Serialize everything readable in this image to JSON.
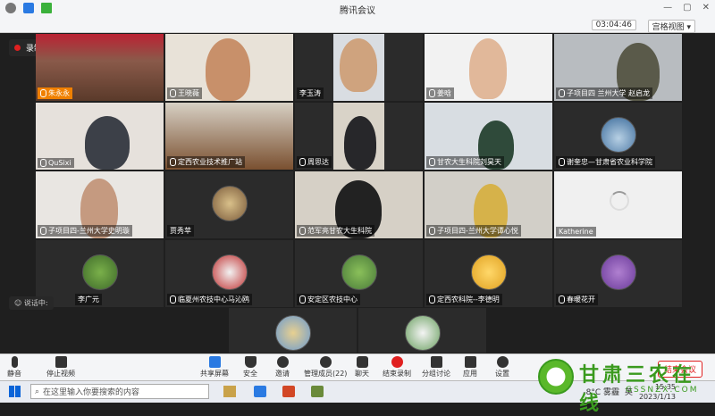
{
  "window": {
    "title": "腾讯会议",
    "timer": "03:04:46",
    "view_label": "宫格视图"
  },
  "recording": {
    "label": "录制中"
  },
  "speaking_label": "说话中:",
  "participants": [
    {
      "name": "朱永永"
    },
    {
      "name": "王晓薇"
    },
    {
      "name": "李玉涛"
    },
    {
      "name": "姜晗"
    },
    {
      "name": "子项目四 兰州大学 赵启龙"
    },
    {
      "name": "QuSixi"
    },
    {
      "name": "定西农业技术推广站"
    },
    {
      "name": "周思达"
    },
    {
      "name": "甘农大生科院刘昊天"
    },
    {
      "name": "谢奎忠—甘肃省农业科学院"
    },
    {
      "name": "子项目四-兰州大学史明璇"
    },
    {
      "name": "贾秀苹"
    },
    {
      "name": "范军亮甘农大生科院"
    },
    {
      "name": "子项目四-兰州大学谭心悦"
    },
    {
      "name": "Katherine"
    },
    {
      "name": "李广元"
    },
    {
      "name": "临夏州农技中心马沁鸥"
    },
    {
      "name": "安定区农技中心"
    },
    {
      "name": "定西农科院--李德明"
    },
    {
      "name": "春暖花开"
    }
  ],
  "bottom_toolbar": {
    "mute": "静音",
    "stop_video": "停止视频",
    "share": "共享屏幕",
    "security": "安全",
    "invite": "邀请",
    "members": "管理成员(22)",
    "chat": "聊天",
    "end_record": "结束录制",
    "breakout": "分组讨论",
    "apps": "应用",
    "settings": "设置",
    "end_meeting": "结束会议"
  },
  "taskbar": {
    "search_placeholder": "在这里输入你要搜索的内容",
    "weather": "-8°C 雾霾",
    "ime": "英",
    "time": "15:35",
    "date": "2023/1/13"
  },
  "watermark": {
    "text": "甘肃三农在线",
    "sub": "GSSNZX.COM"
  }
}
